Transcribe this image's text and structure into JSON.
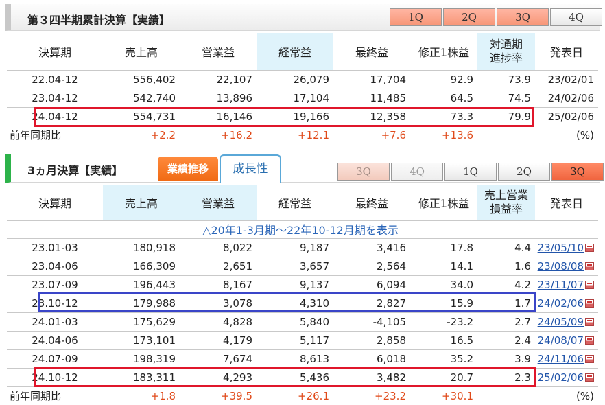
{
  "cumulative": {
    "title": "第３四半期累計決算【実績】",
    "tabs": [
      "1Q",
      "2Q",
      "3Q",
      "4Q"
    ],
    "headers": [
      "決算期",
      "売上高",
      "営業益",
      "経常益",
      "最終益",
      "修正1株益",
      "対通期",
      "進捗率",
      "発表日"
    ],
    "rows": [
      [
        "22.04-12",
        "556,402",
        "22,107",
        "26,079",
        "17,704",
        "92.9",
        "73.9",
        "23/02/01"
      ],
      [
        "23.04-12",
        "542,740",
        "13,896",
        "17,104",
        "11,485",
        "64.5",
        "74.5",
        "24/02/06"
      ],
      [
        "24.04-12",
        "554,731",
        "16,146",
        "19,166",
        "12,358",
        "73.3",
        "79.9",
        "25/02/06"
      ]
    ],
    "yoy_label": "前年同期比",
    "yoy": [
      "+2.2",
      "+16.2",
      "+12.1",
      "+7.6",
      "+13.6"
    ],
    "unit": "(%)"
  },
  "quarterly": {
    "title": "3ヵ月決算【実績】",
    "tab_active": "業績推移",
    "tab_growth": "成長性",
    "tabs": [
      "3Q",
      "4Q",
      "1Q",
      "2Q",
      "3Q"
    ],
    "headers": [
      "決算期",
      "売上高",
      "営業益",
      "経常益",
      "最終益",
      "修正1株益",
      "売上営業",
      "損益率",
      "発表日"
    ],
    "notice": "△20年1-3月期〜22年10-12月期を表示",
    "rows": [
      [
        "23.01-03",
        "180,918",
        "8,022",
        "9,187",
        "3,416",
        "17.8",
        "4.4",
        "23/05/10"
      ],
      [
        "23.04-06",
        "166,309",
        "2,651",
        "3,657",
        "2,564",
        "14.1",
        "1.6",
        "23/08/08"
      ],
      [
        "23.07-09",
        "196,443",
        "8,167",
        "9,137",
        "6,094",
        "34.0",
        "4.2",
        "23/11/07"
      ],
      [
        "23.10-12",
        "179,988",
        "3,078",
        "4,310",
        "2,827",
        "15.9",
        "1.7",
        "24/02/06"
      ],
      [
        "24.01-03",
        "175,629",
        "4,828",
        "5,840",
        "-4,105",
        "-23.2",
        "2.7",
        "24/05/09"
      ],
      [
        "24.04-06",
        "173,101",
        "4,179",
        "5,117",
        "2,858",
        "16.5",
        "2.4",
        "24/08/07"
      ],
      [
        "24.07-09",
        "198,319",
        "7,674",
        "8,613",
        "6,018",
        "35.2",
        "3.9",
        "24/11/06"
      ],
      [
        "24.10-12",
        "183,311",
        "4,293",
        "5,436",
        "3,482",
        "20.7",
        "2.3",
        "25/02/06"
      ]
    ],
    "yoy_label": "前年同期比",
    "yoy": [
      "+1.8",
      "+39.5",
      "+26.1",
      "+23.2",
      "+30.1"
    ],
    "unit": "(%)"
  }
}
